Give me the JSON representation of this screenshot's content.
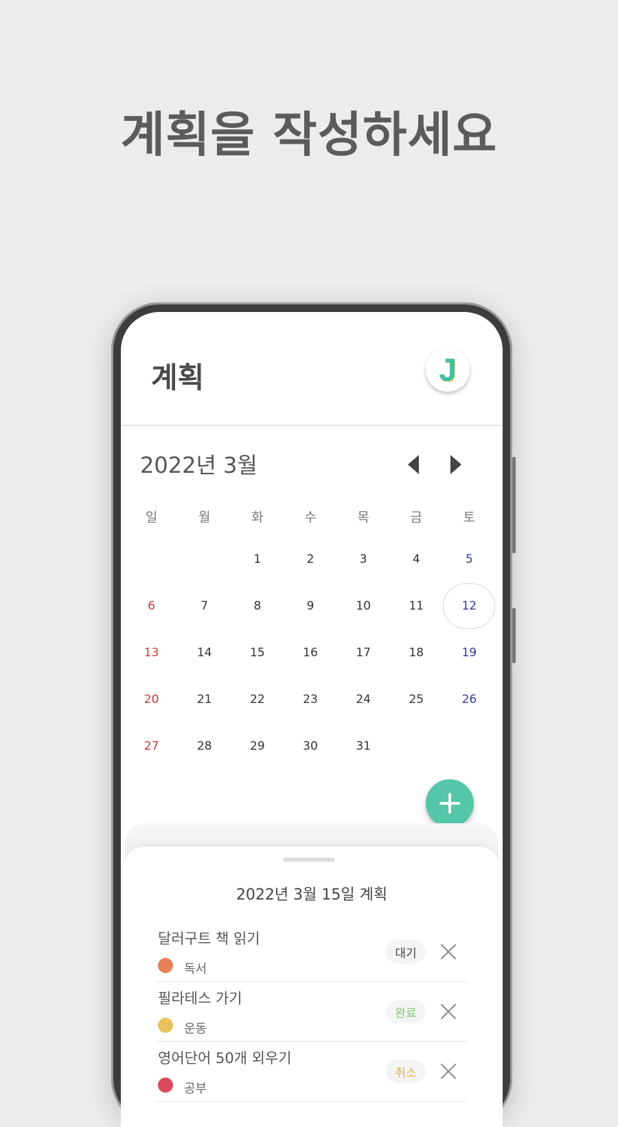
{
  "headline": "계획을 작성하세요",
  "app": {
    "title": "계획",
    "avatar_letter": "J",
    "avatar_icon": "app-logo-j",
    "month_label": "2022년 3월",
    "prev_icon": "triangle-left",
    "next_icon": "triangle-right",
    "weekdays": [
      "일",
      "월",
      "화",
      "수",
      "목",
      "금",
      "토"
    ],
    "days": [
      {
        "label": "",
        "kind": ""
      },
      {
        "label": "",
        "kind": ""
      },
      {
        "label": "1",
        "kind": ""
      },
      {
        "label": "2",
        "kind": ""
      },
      {
        "label": "3",
        "kind": ""
      },
      {
        "label": "4",
        "kind": ""
      },
      {
        "label": "5",
        "kind": "sat"
      },
      {
        "label": "6",
        "kind": "sun"
      },
      {
        "label": "7",
        "kind": ""
      },
      {
        "label": "8",
        "kind": ""
      },
      {
        "label": "9",
        "kind": ""
      },
      {
        "label": "10",
        "kind": ""
      },
      {
        "label": "11",
        "kind": ""
      },
      {
        "label": "12",
        "kind": "sat sel"
      },
      {
        "label": "13",
        "kind": "sun"
      },
      {
        "label": "14",
        "kind": ""
      },
      {
        "label": "15",
        "kind": ""
      },
      {
        "label": "16",
        "kind": ""
      },
      {
        "label": "17",
        "kind": ""
      },
      {
        "label": "18",
        "kind": ""
      },
      {
        "label": "19",
        "kind": "sat"
      },
      {
        "label": "20",
        "kind": "sun"
      },
      {
        "label": "21",
        "kind": ""
      },
      {
        "label": "22",
        "kind": ""
      },
      {
        "label": "23",
        "kind": ""
      },
      {
        "label": "24",
        "kind": ""
      },
      {
        "label": "25",
        "kind": ""
      },
      {
        "label": "26",
        "kind": "sat"
      },
      {
        "label": "27",
        "kind": "sun"
      },
      {
        "label": "28",
        "kind": ""
      },
      {
        "label": "29",
        "kind": ""
      },
      {
        "label": "30",
        "kind": ""
      },
      {
        "label": "31",
        "kind": ""
      }
    ],
    "selected_day": "12",
    "fab_icon": "plus",
    "sheet": {
      "title": "2022년 3월 15일 계획",
      "plans": [
        {
          "name": "달러구트 책 읽기",
          "category": "독서",
          "category_color": "#e8825a",
          "status": "대기",
          "status_color": "#444444"
        },
        {
          "name": "필라테스 가기",
          "category": "운동",
          "category_color": "#e8c25a",
          "status": "완료",
          "status_color": "#7dc96b"
        },
        {
          "name": "영어단어 50개 외우기",
          "category": "공부",
          "category_color": "#d94a5c",
          "status": "취소",
          "status_color": "#e0b24a"
        }
      ]
    }
  },
  "colors": {
    "background": "#ececec",
    "accent": "#55c7a8",
    "sunday": "#c83a3a",
    "saturday": "#2f3b9c"
  }
}
